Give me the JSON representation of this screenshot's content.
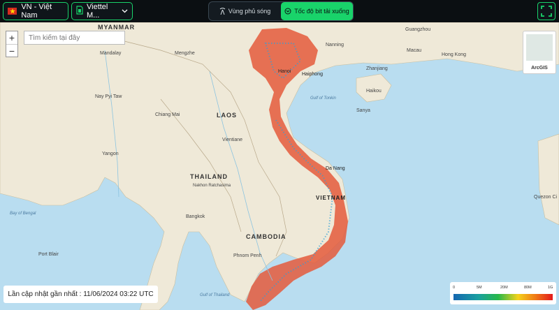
{
  "header": {
    "country_label": "VN - Việt Nam",
    "operator_label": "Viettel M...",
    "tabs": [
      {
        "label": "Vùng phủ sóng",
        "active": false
      },
      {
        "label": "Tốc độ bit tải xuống",
        "active": true
      }
    ]
  },
  "map": {
    "search_placeholder": "Tìm kiếm tại đây",
    "zoom_in": "+",
    "zoom_out": "−",
    "basemap_label": "ArcGIS",
    "last_updated": "Lần cập nhật gần nhất : 11/06/2024 03:22 UTC",
    "legend": {
      "ticks": [
        "0",
        "5M",
        "20M",
        "80M",
        "1G"
      ]
    },
    "labels": {
      "myanmar": "MYANMAR",
      "laos": "LAOS",
      "thailand": "THAILAND",
      "cambodia": "CAMBODIA",
      "vietnam": "VIETNAM",
      "mandalay": "Mandalay",
      "mengzhe": "Mengzhe",
      "naypyitaw": "Nay Pyi Taw",
      "chiangmai": "Chiang Mai",
      "yangon": "Yangon",
      "vientiane": "Vientiane",
      "nakhon": "Nakhon\nRatchasima",
      "bangkok": "Bangkok",
      "phnompenh": "Phnom Penh",
      "danang": "Da Nang",
      "hanoi": "Hanoi",
      "haiphong": "Haiphong",
      "nanning": "Nanning",
      "guangzhou": "Guangzhou",
      "hongkong": "Hong Kong",
      "macau": "Macau",
      "zhanjiang": "Zhanjiang",
      "haikou": "Haikou",
      "sanya": "Sanya",
      "baybengal": "Bay of\nBengal",
      "gulftonkin": "Gulf of\nTonkin",
      "gulfthailand": "Gulf of\nThailand",
      "portblair": "Port Blair",
      "quezon": "Quezon Ci"
    }
  },
  "colors": {
    "accent": "#19d36a",
    "topbar": "#0b0f12"
  }
}
